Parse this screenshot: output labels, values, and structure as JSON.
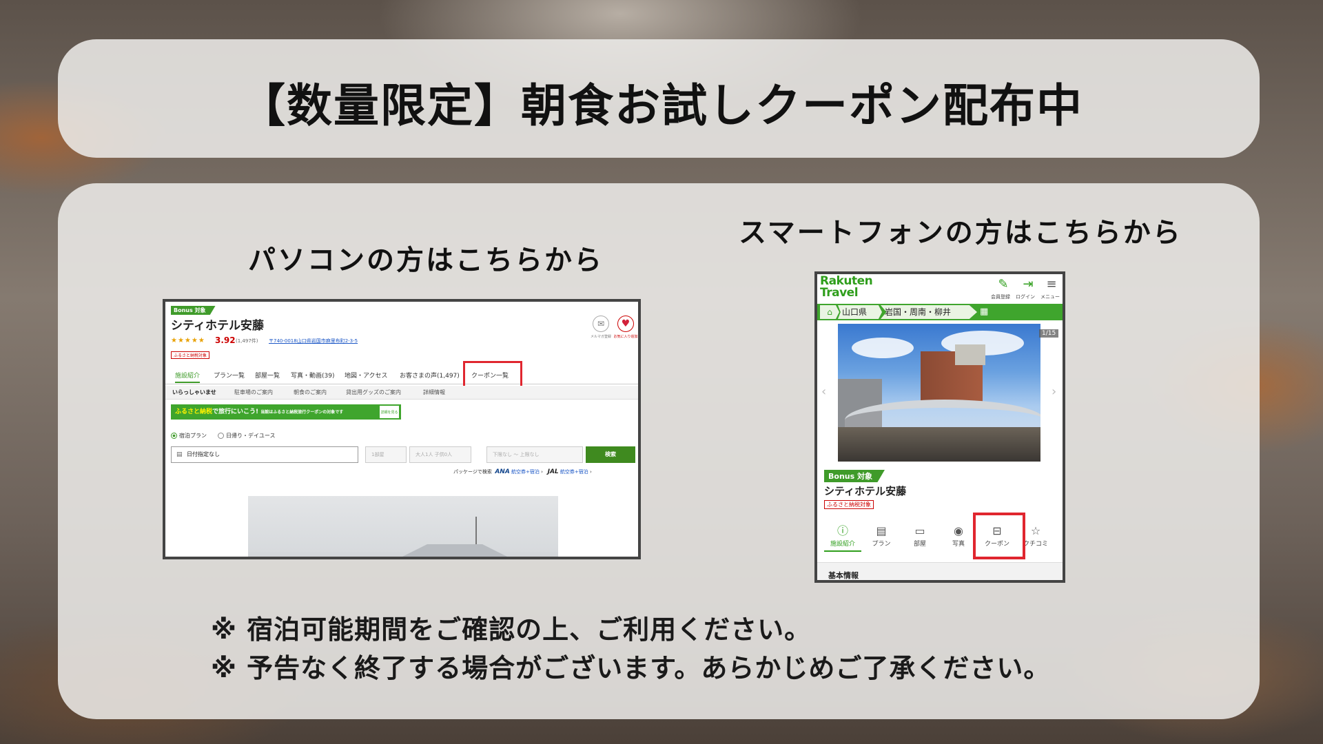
{
  "title": "【数量限定】朝食お試しクーポン配布中",
  "pc_heading": "パソコンの方はこちらから",
  "sp_heading": "スマートフォンの方はこちらから",
  "notes": [
    "※ 宿泊可能期間をご確認の上、ご利用ください。",
    "※ 予告なく終了する場合がございます。あらかじめご了承ください。"
  ],
  "pc": {
    "bonus_label": "Bonus 対象",
    "hotel_name": "シティホテル安藤",
    "stars": "★★★★★",
    "rating": "3.92",
    "review_count": "(1,497件)",
    "address": "〒740-0018山口県岩国市麻里布町2-3-5",
    "furusato_label": "ふるさと納税対象",
    "mail_label": "メルマガ登録",
    "favorite_label": "お気に入り追加",
    "tabs": [
      "施設紹介",
      "プラン一覧",
      "部屋一覧",
      "写真・動画(39)",
      "地図・アクセス",
      "お客さまの声(1,497)",
      "クーポン一覧"
    ],
    "subnav": [
      "いらっしゃいませ",
      "駐車場のご案内",
      "朝食のご案内",
      "貸出用グッズのご案内",
      "詳細情報"
    ],
    "banner_text_a": "ふるさと納税",
    "banner_text_b": "で旅行にいこう!",
    "banner_text_c": "当館はふるさと納税旅行クーポンの対象です",
    "banner_btn": "詳細を見る",
    "radio_stay": "宿泊プラン",
    "radio_day": "日帰り・デイユース",
    "date_placeholder": "日付指定なし",
    "rooms_field": "1部屋",
    "guests_field": "大人1人 子供0人",
    "price_field": "下限なし ～ 上限なし",
    "search_button": "検索",
    "package_label": "パッケージで検索",
    "ana_label": "ANA",
    "ana_link": "航空券+宿泊",
    "jal_label": "JAL",
    "jal_link": "航空券+宿泊"
  },
  "sp": {
    "logo_line1": "Rakuten",
    "logo_line2": "Travel",
    "header_labels": [
      "会員登録",
      "ログイン",
      "メニュー"
    ],
    "breadcrumbs": [
      "山口県",
      "岩国・周南・柳井"
    ],
    "pager": "1/15",
    "bonus_label": "Bonus 対象",
    "hotel_name": "シティホテル安藤",
    "furusato_label": "ふるさと納税対象",
    "tabs": [
      "施設紹介",
      "プラン",
      "部屋",
      "写真",
      "クーポン",
      "クチコミ"
    ],
    "section_label": "基本情報"
  },
  "colors": {
    "accent_green": "#3f9b2a",
    "highlight_red": "#e0262f"
  }
}
